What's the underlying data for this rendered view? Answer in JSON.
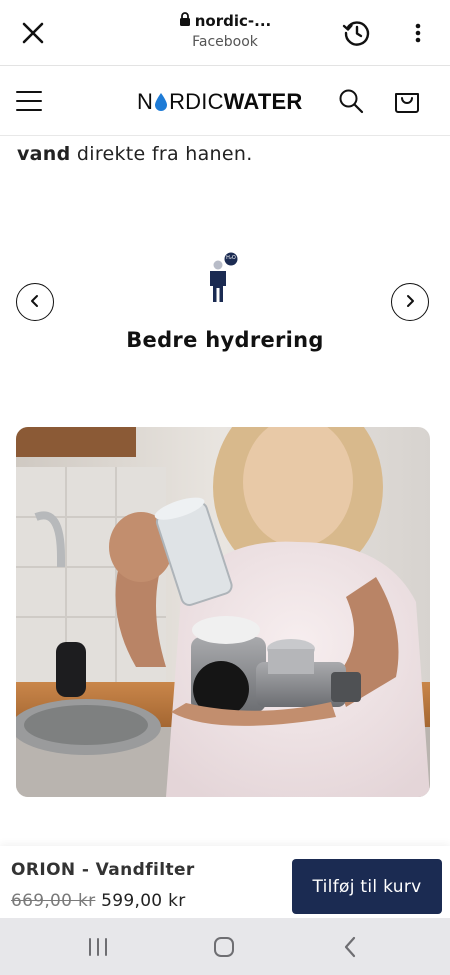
{
  "browser": {
    "url_text": "nordic-...",
    "source_label": "Facebook",
    "icons": [
      "close-icon",
      "lock-icon",
      "history-icon",
      "more-vertical-icon"
    ]
  },
  "header": {
    "logo_parts": {
      "n": "N",
      "rdic": "RDIC",
      "water": "WATER"
    },
    "icons": [
      "hamburger-icon",
      "search-icon",
      "cart-icon"
    ]
  },
  "intro": {
    "bold": "vand",
    "rest": " direkte fra hanen."
  },
  "feature": {
    "title": "Bedre hydrering",
    "badge": "H₂O",
    "icons": [
      "person-hydration-icon",
      "chevron-left-icon",
      "chevron-right-icon"
    ]
  },
  "product_image": {
    "description_icon": "photo-woman-holding-water-filter"
  },
  "sticky_bar": {
    "product_name": "ORION - Vandfilter",
    "old_price": "669,00 kr",
    "price": "599,00 kr",
    "button_label": "Tilføj til kurv"
  },
  "android_nav": {
    "icons": [
      "recent-apps-icon",
      "home-icon",
      "back-icon"
    ]
  },
  "colors": {
    "accent_navy": "#1b2b52",
    "logo_drop_blue": "#1e7bd6",
    "nav_bar_bg": "#e7e7ea"
  }
}
